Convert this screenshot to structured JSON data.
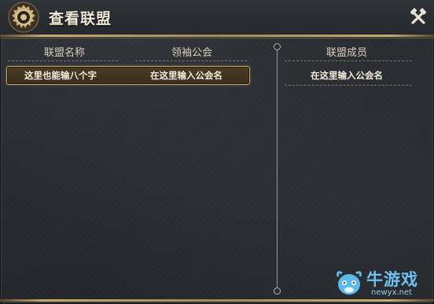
{
  "window": {
    "title": "查看联盟"
  },
  "columns": {
    "alliance_name": "联盟名称",
    "leader_guild": "领袖公会",
    "members": "联盟成员"
  },
  "selected_row": {
    "alliance_name": "这里也能输八个字",
    "leader_guild": "在这里输入公会名"
  },
  "members": [
    "在这里输入公会名"
  ],
  "icons": {
    "emblem": "gear-emblem-icon",
    "close": "crossed-tools-close-icon"
  },
  "colors": {
    "accent_gold": "#c9a66a",
    "text": "#f4ecdc",
    "header_text": "#d8cfbd"
  },
  "watermark": {
    "name": "牛游戏",
    "url": "newyx.net"
  }
}
